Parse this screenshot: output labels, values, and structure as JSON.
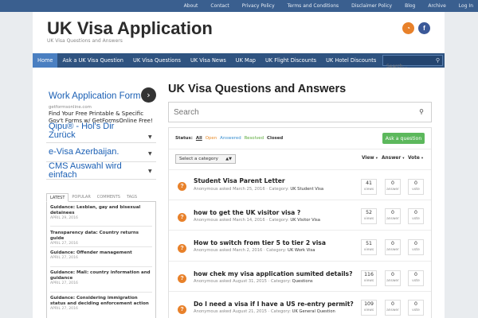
{
  "topbar": {
    "links": [
      "About",
      "Contact",
      "Privacy Policy",
      "Terms and Conditions",
      "Disclaimer Policy",
      "Blog",
      "Archive",
      "Log In"
    ]
  },
  "header": {
    "title": "UK Visa Application",
    "tagline": "UK Visa Questions and Answers",
    "social": {
      "rss_icon": "◔",
      "fb_icon": "f"
    }
  },
  "nav": {
    "items": [
      "Home",
      "Ask a UK Visa Question",
      "UK Visa Questions",
      "UK Visa News",
      "UK Map",
      "UK Flight Discounts",
      "UK Hotel Discounts"
    ],
    "active": "Home",
    "search_placeholder": "Search..."
  },
  "sidebar": {
    "ad": {
      "title": "Work Application Form",
      "url": "getformsonline.com",
      "text": "Find Your Free Printable & Specific Gov't Forms w/ GetFormsOnline Free!"
    },
    "ad_links": [
      "Qipu® - Hol's Dir Zurück",
      "e-Visa Azerbaijan.",
      "CMS Auswahl wird einfach"
    ],
    "tabs": [
      "LATEST",
      "POPULAR",
      "COMMENTS",
      "TAGS"
    ],
    "posts": [
      {
        "title": "Guidance: Lesbian, gay and bisexual detainees",
        "date": "APRIL 29, 2016"
      },
      {
        "title": "Transparency data: Country returns guide",
        "date": "APRIL 27, 2016"
      },
      {
        "title": "Guidance: Offender management",
        "date": "APRIL 27, 2016"
      },
      {
        "title": "Guidance: Mali: country information and guidance",
        "date": "APRIL 27, 2016"
      },
      {
        "title": "Guidance: Considering immigration status and deciding enforcement action",
        "date": "APRIL 27, 2016"
      }
    ]
  },
  "main": {
    "title": "UK Visa Questions and Answers",
    "search_placeholder": "Search",
    "status_label": "Status:",
    "filters": [
      "All",
      "Open",
      "Answered",
      "Resolved",
      "Closed"
    ],
    "ask_button": "Ask a question",
    "category_select": "Select a category",
    "sort_headers": [
      "View",
      "Answer",
      "Vote"
    ],
    "views_label": "views",
    "answer_label": "answer",
    "vote_label": "vote",
    "category_prefix": "Category:",
    "questions": [
      {
        "title": "Student Visa Parent Letter",
        "meta": "Anonymous asked March 25, 2016 ·",
        "category": "UK Student Visa",
        "views": "41",
        "answers": "0",
        "votes": "0"
      },
      {
        "title": "how to get the UK visitor visa ?",
        "meta": "Anonymous asked March 14, 2016 ·",
        "category": "UK Visitor Visa",
        "views": "52",
        "answers": "0",
        "votes": "0"
      },
      {
        "title": "How to switch from tier 5 to tier 2 visa",
        "meta": "Anonymous asked March 2, 2016 ·",
        "category": "UK Work Visa",
        "views": "51",
        "answers": "0",
        "votes": "0"
      },
      {
        "title": "how chek my visa application sumited details?",
        "meta": "Anonymous asked August 31, 2015 ·",
        "category": "Questions",
        "views": "116",
        "answers": "0",
        "votes": "0"
      },
      {
        "title": "Do I need a visa if I have a US re-entry permit?",
        "meta": "Anonymous asked August 21, 2015 ·",
        "category": "UK General Question",
        "views": "109",
        "answers": "0",
        "votes": "0"
      }
    ]
  }
}
